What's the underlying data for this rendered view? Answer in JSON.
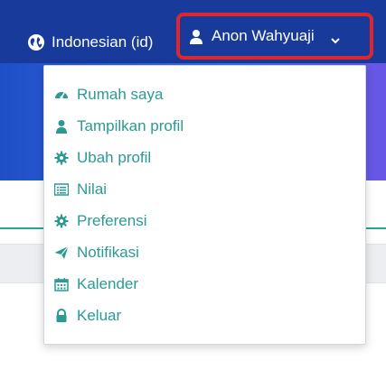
{
  "header": {
    "language_label": "Indonesian (id)",
    "user_name": "Anon Wahyuaji"
  },
  "dropdown": {
    "items": [
      {
        "label": "Rumah saya",
        "icon": "dashboard-icon"
      },
      {
        "label": "Tampilkan profil",
        "icon": "user-icon"
      },
      {
        "label": "Ubah profil",
        "icon": "cog-icon"
      },
      {
        "label": "Nilai",
        "icon": "table-icon"
      },
      {
        "label": "Preferensi",
        "icon": "cog-icon"
      },
      {
        "label": "Notifikasi",
        "icon": "paper-plane-icon"
      },
      {
        "label": "Kalender",
        "icon": "calendar-icon"
      },
      {
        "label": "Keluar",
        "icon": "lock-icon"
      }
    ]
  },
  "colors": {
    "navbar": "#173a9b",
    "highlight_border": "#e0262d",
    "menu_text": "#2b9a93"
  }
}
